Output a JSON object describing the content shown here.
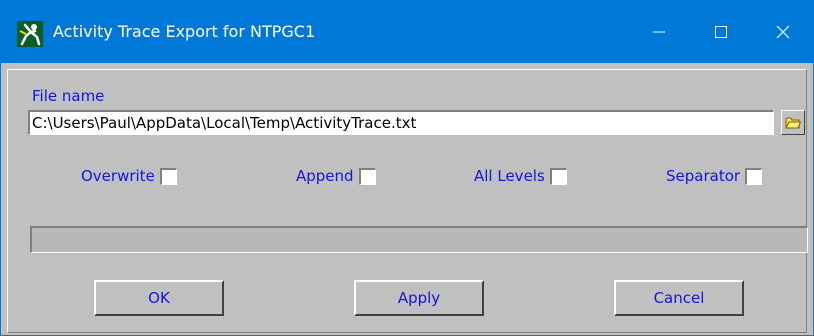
{
  "window": {
    "title": "Activity Trace Export for NTPGC1",
    "accent_color": "#0078d7",
    "controls": {
      "minimize": "minimize-icon",
      "maximize": "maximize-icon",
      "close": "close-icon"
    }
  },
  "file": {
    "label": "File name",
    "value": "C:\\Users\\Paul\\AppData\\Local\\Temp\\ActivityTrace.txt",
    "browse_icon": "folder-icon"
  },
  "options": [
    {
      "label": "Overwrite",
      "checked": false
    },
    {
      "label": "Append",
      "checked": false
    },
    {
      "label": "All Levels",
      "checked": false
    },
    {
      "label": "Separator",
      "checked": false
    }
  ],
  "progress": {
    "value": 0
  },
  "buttons": {
    "ok": "OK",
    "apply": "Apply",
    "cancel": "Cancel"
  },
  "colors": {
    "label_text": "#1414e0",
    "dialog_bg": "#c0c0c0"
  }
}
